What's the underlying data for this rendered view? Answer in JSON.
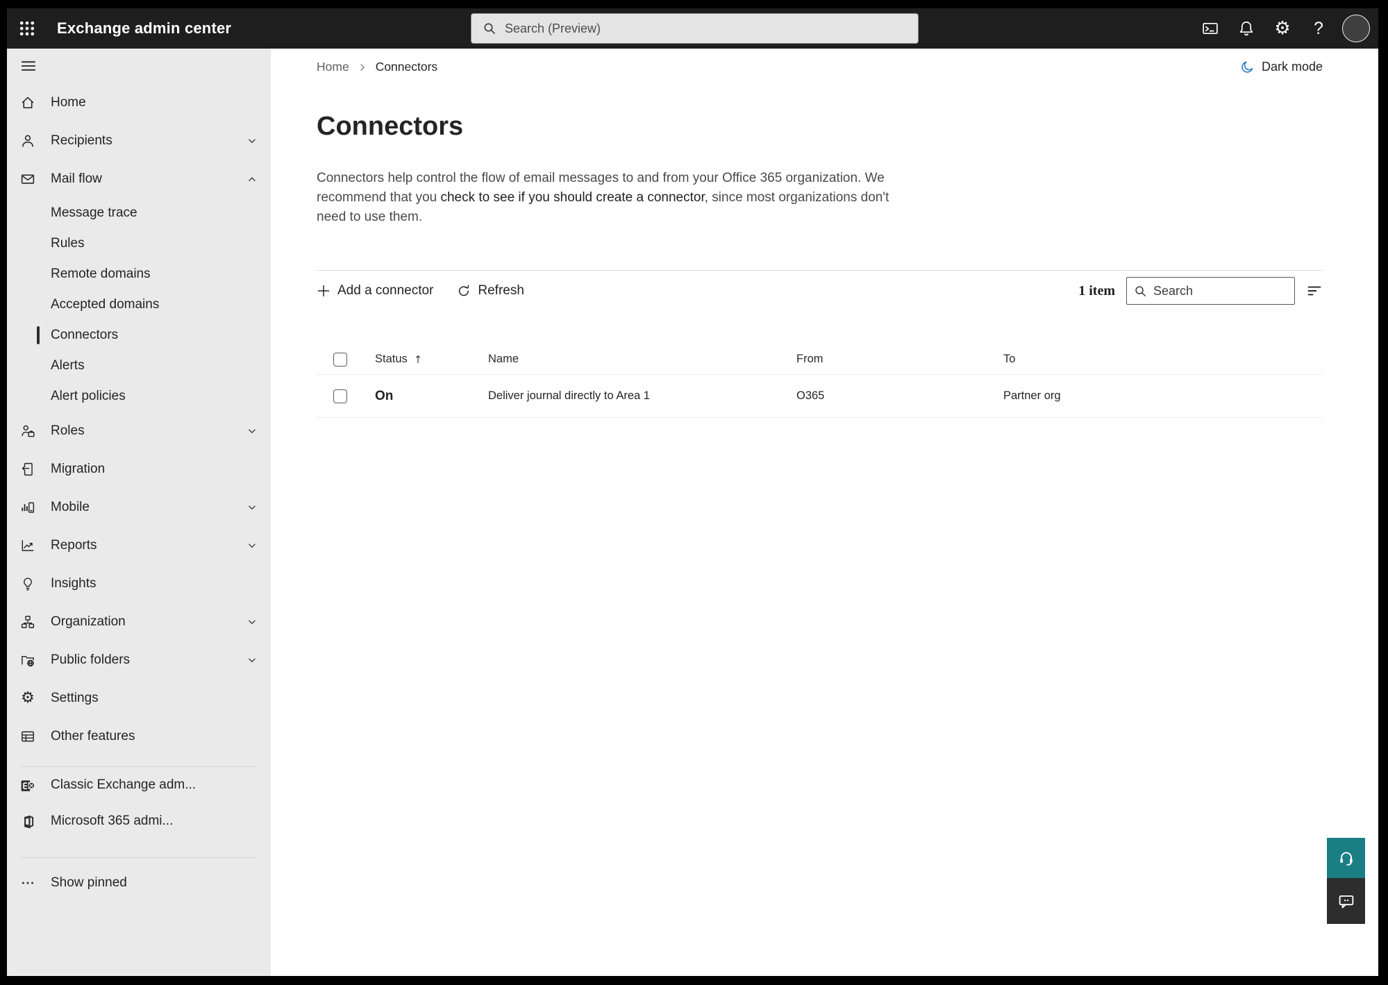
{
  "topbar": {
    "app_title": "Exchange admin center",
    "search_placeholder": "Search (Preview)"
  },
  "breadcrumb": {
    "home": "Home",
    "current": "Connectors"
  },
  "dark_mode": {
    "label": "Dark mode"
  },
  "page": {
    "title": "Connectors",
    "description_prefix": "Connectors help control the flow of email messages to and from your Office 365 organization. We recommend that you ",
    "description_emphasis": "check to see if you should create a connector",
    "description_suffix": ", since most organizations don't need to use them."
  },
  "toolbar": {
    "add_connector": "Add a connector",
    "refresh": "Refresh",
    "item_count": "1 item",
    "search_placeholder": "Search"
  },
  "table": {
    "headers": [
      "Status",
      "Name",
      "From",
      "To"
    ],
    "sort_column": "Status",
    "sort_direction": "ascending",
    "sort_arrow": "↑",
    "rows": [
      {
        "status": "On",
        "name": "Deliver journal directly to Area 1",
        "from": "O365",
        "to": "Partner org"
      }
    ]
  },
  "sidebar": {
    "items": [
      {
        "label": "Home",
        "icon": "home-icon"
      },
      {
        "label": "Recipients",
        "icon": "person-icon",
        "expandable": true
      },
      {
        "label": "Mail flow",
        "icon": "mail-icon",
        "expandable": true,
        "expanded": true
      },
      {
        "label": "Message trace",
        "parent": "Mail flow"
      },
      {
        "label": "Rules",
        "parent": "Mail flow"
      },
      {
        "label": "Remote domains",
        "parent": "Mail flow"
      },
      {
        "label": "Accepted domains",
        "parent": "Mail flow"
      },
      {
        "label": "Connectors",
        "parent": "Mail flow",
        "selected": true
      },
      {
        "label": "Alerts",
        "parent": "Mail flow"
      },
      {
        "label": "Alert policies",
        "parent": "Mail flow"
      },
      {
        "label": "Roles",
        "icon": "roles-icon",
        "expandable": true
      },
      {
        "label": "Migration",
        "icon": "migration-icon"
      },
      {
        "label": "Mobile",
        "icon": "mobile-icon",
        "expandable": true
      },
      {
        "label": "Reports",
        "icon": "reports-icon",
        "expandable": true
      },
      {
        "label": "Insights",
        "icon": "lightbulb-icon"
      },
      {
        "label": "Organization",
        "icon": "org-chart-icon",
        "expandable": true
      },
      {
        "label": "Public folders",
        "icon": "folder-globe-icon",
        "expandable": true
      },
      {
        "label": "Settings",
        "icon": "gear-icon"
      },
      {
        "label": "Other features",
        "icon": "table-icon"
      },
      {
        "label": "Classic Exchange adm...",
        "icon": "exchange-logo"
      },
      {
        "label": "Microsoft 365 admi...",
        "icon": "m365-logo"
      },
      {
        "label": "Show pinned",
        "icon": "ellipsis-icon"
      }
    ]
  },
  "icons": {
    "topbar": [
      "app-launcher-waffle",
      "terminal",
      "bell",
      "gear",
      "help",
      "avatar"
    ],
    "floating": [
      "headset-help",
      "feedback-bubble"
    ]
  },
  "colors": {
    "topbar_bg": "#1e1e1e",
    "sidebar_bg": "#eaeaea",
    "selected_indicator": "#2c2c2c",
    "dark_mode_moon": "#2076c9",
    "help_teal": "#1a7e84",
    "feedback_dark": "#2d2d2d"
  }
}
